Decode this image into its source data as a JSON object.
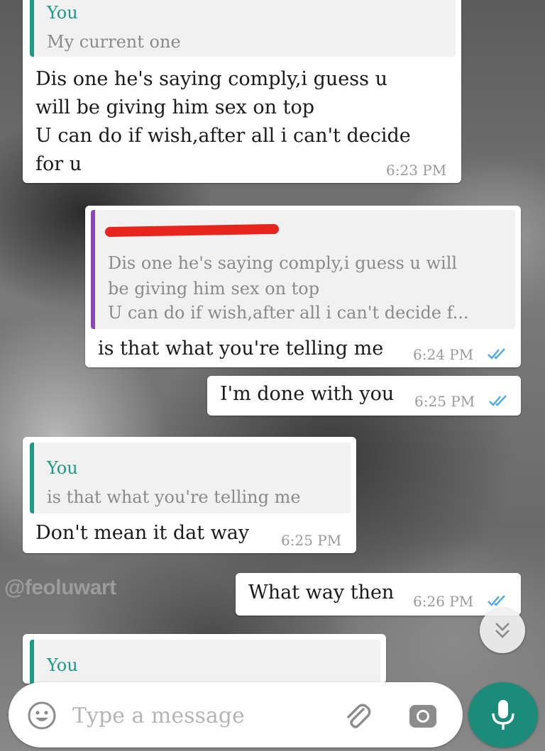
{
  "watermark": "@feoluwart",
  "messages": [
    {
      "direction": "incoming",
      "quote": {
        "author": "You",
        "text": [
          "My current one"
        ]
      },
      "lines": [
        "Dis one he's saying comply,i guess u",
        "will be giving him sex on top",
        "U can do if wish,after all i can't decide",
        "for u"
      ],
      "time": "6:23 PM"
    },
    {
      "direction": "outgoing",
      "quote": {
        "author": "",
        "text": [
          "Dis one he's saying comply,i guess u will",
          "be giving him sex on top",
          "U can do if wish,after all i can't decide f..."
        ]
      },
      "lines": [
        "is that what you're telling me"
      ],
      "time": "6:24 PM",
      "read": true
    },
    {
      "direction": "outgoing",
      "lines": [
        "I'm done with you"
      ],
      "time": "6:25 PM",
      "read": true
    },
    {
      "direction": "incoming",
      "quote": {
        "author": "You",
        "text": [
          "is that what you're telling me"
        ]
      },
      "lines": [
        "Don't mean it dat way"
      ],
      "time": "6:25 PM"
    },
    {
      "direction": "outgoing",
      "lines": [
        "What way then"
      ],
      "time": "6:26 PM",
      "read": true
    },
    {
      "direction": "incoming",
      "quote": {
        "author": "You",
        "text": []
      },
      "lines": []
    }
  ],
  "composer": {
    "placeholder": "Type a message",
    "value": ""
  },
  "icons": {
    "emoji": "emoji-icon",
    "attach": "paperclip-icon",
    "camera": "camera-icon",
    "mic": "microphone-icon",
    "scroll": "chevron-double-down-icon",
    "read_receipt": "double-check-icon"
  },
  "colors": {
    "accent": "#1b8b7a",
    "quote_bar_self": "#1f9a86",
    "quote_bar_other": "#8a47b6",
    "read_tick": "#4fa8e8",
    "bubble": "#ffffff"
  }
}
